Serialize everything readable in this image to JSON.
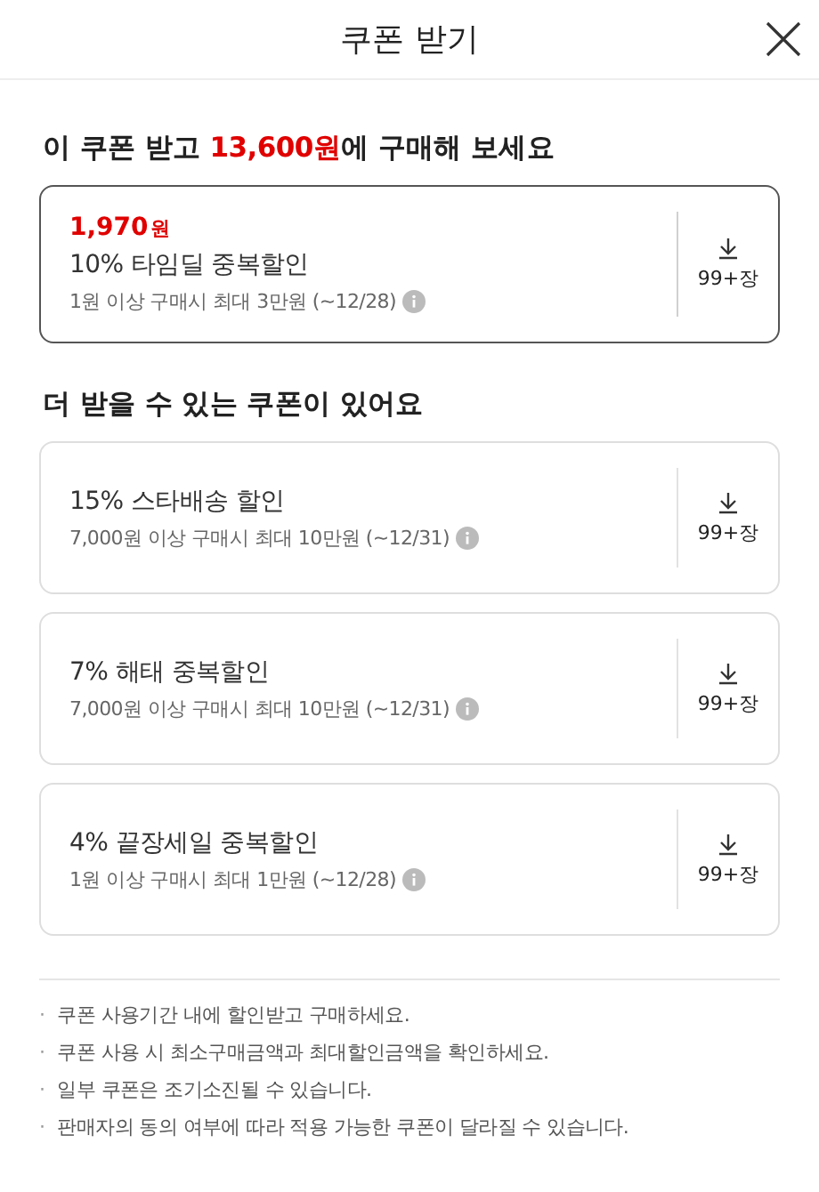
{
  "header": {
    "title": "쿠폰 받기"
  },
  "best_section": {
    "heading": [
      {
        "text": "이 쿠폰 받고 ",
        "highlight": false
      },
      {
        "text": "13,600원",
        "highlight": true
      },
      {
        "text": "에 구매해 보세요",
        "highlight": false
      }
    ],
    "coupons": [
      {
        "price_amount": "1,970",
        "price_unit": "원",
        "name": "10% 타임딜 중복할인",
        "condition": "1원 이상 구매시 최대 3만원 (~12/28)",
        "count": "99+장",
        "highlighted": true
      }
    ]
  },
  "more_section": {
    "heading": "더 받을 수 있는 쿠폰이 있어요",
    "coupons": [
      {
        "name": "15% 스타배송 할인",
        "condition": "7,000원 이상 구매시 최대 10만원 (~12/31)",
        "count": "99+장",
        "highlighted": false
      },
      {
        "name": "7% 해태 중복할인",
        "condition": "7,000원 이상 구매시 최대 10만원 (~12/31)",
        "count": "99+장",
        "highlighted": false
      },
      {
        "name": "4% 끝장세일 중복할인",
        "condition": "1원 이상 구매시 최대 1만원 (~12/28)",
        "count": "99+장",
        "highlighted": false
      }
    ]
  },
  "notes": [
    {
      "bullet": "·",
      "text": "쿠폰 사용기간 내에 할인받고 구매하세요."
    },
    {
      "bullet": "·",
      "text": "쿠폰 사용 시 최소구매금액과 최대할인금액을 확인하세요."
    },
    {
      "bullet": "·",
      "text": "일부 쿠폰은 조기소진될 수 있습니다."
    },
    {
      "bullet": "·",
      "text": "판매자의 동의 여부에 따라 적용 가능한 쿠폰이 달라질 수 있습니다."
    }
  ]
}
